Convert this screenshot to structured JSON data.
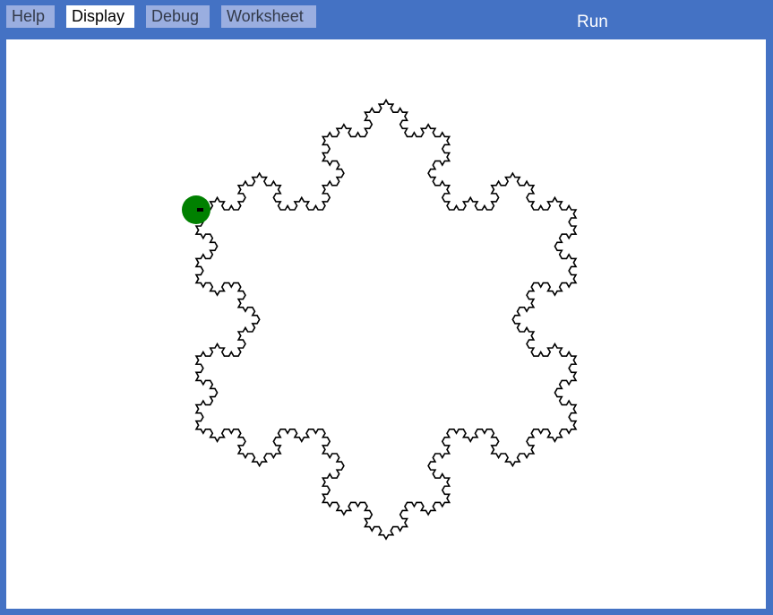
{
  "tabs": [
    {
      "label": "Help",
      "active": false
    },
    {
      "label": "Display",
      "active": true
    },
    {
      "label": "Debug",
      "active": false
    },
    {
      "label": "Worksheet",
      "active": false
    }
  ],
  "toolbar": {
    "run_label": "Run"
  },
  "colors": {
    "frame": "#4472c4",
    "tab_inactive": "#9aaee0",
    "tab_active": "#ffffff",
    "turtle": "#008000",
    "line": "#000000"
  },
  "drawing": {
    "shape": "koch-snowflake-icon",
    "turtle": "turtle-icon"
  }
}
